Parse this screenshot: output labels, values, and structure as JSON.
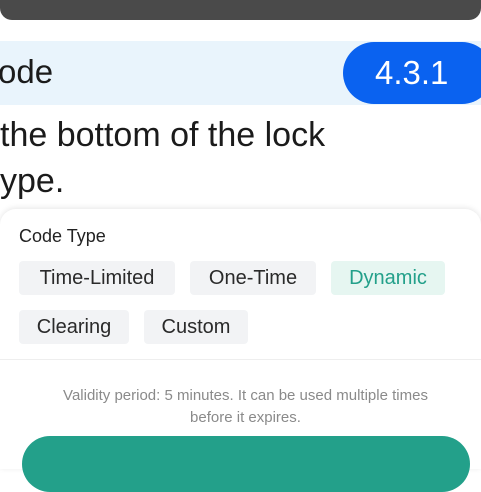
{
  "header": {
    "title_fragment": "ode",
    "version": "4.3.1"
  },
  "instruction": {
    "line1": "the bottom of the lock",
    "line2": "ype."
  },
  "code_type": {
    "label": "Code Type",
    "options": [
      {
        "label": "Time-Limited",
        "selected": false
      },
      {
        "label": "One-Time",
        "selected": false
      },
      {
        "label": "Dynamic",
        "selected": true
      },
      {
        "label": "Clearing",
        "selected": false
      },
      {
        "label": "Custom",
        "selected": false
      }
    ],
    "hint_line1": "Validity period: 5 minutes. It can be used multiple times",
    "hint_line2": "before it expires."
  },
  "colors": {
    "accent_teal": "#23a08a",
    "version_blue": "#0a62f0",
    "header_band": "#e9f4fc"
  }
}
